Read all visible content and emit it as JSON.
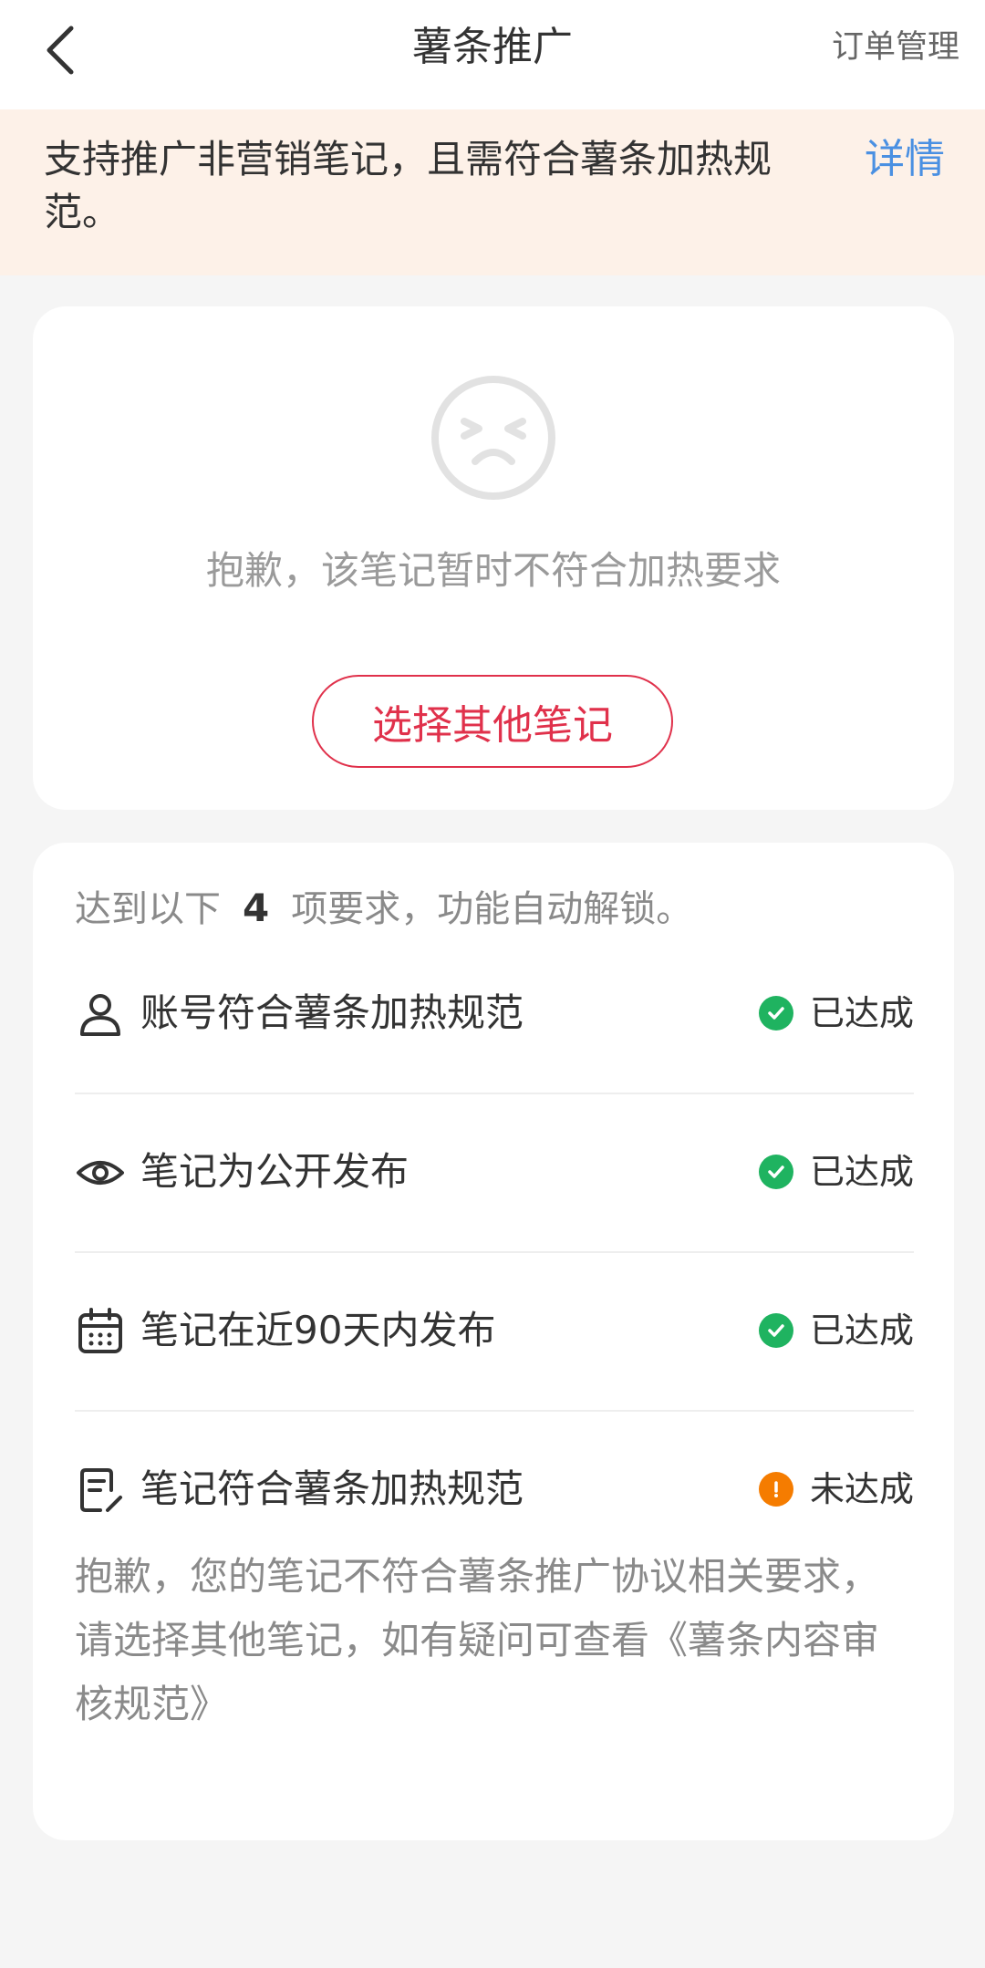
{
  "header": {
    "title": "薯条推广",
    "action_label": "订单管理",
    "back_icon": "back-arrow-icon"
  },
  "notice": {
    "text": "支持推广非营销笔记，且需符合薯条加热规范。",
    "link_label": "详情"
  },
  "empty_state": {
    "icon": "sad-face-icon",
    "message": "抱歉，该笔记暂时不符合加热要求",
    "button_label": "选择其他笔记"
  },
  "requirements": {
    "intro_prefix": "达到以下",
    "intro_count": "4",
    "intro_suffix": "项要求，功能自动解锁。",
    "items": [
      {
        "icon": "user-icon",
        "label": "账号符合薯条加热规范",
        "status": "已达成",
        "status_color": "#1fb360"
      },
      {
        "icon": "eye-icon",
        "label": "笔记为公开发布",
        "status": "已达成",
        "status_color": "#1fb360"
      },
      {
        "icon": "calendar-icon",
        "label": "笔记在近90天内发布",
        "status": "已达成",
        "status_color": "#1fb360"
      },
      {
        "icon": "note-edit-icon",
        "label": "笔记符合薯条加热规范",
        "status": "未达成",
        "status_color": "#f57c00"
      }
    ],
    "detail": "抱歉，您的笔记不符合薯条推广协议相关要求，请选择其他笔记，如有疑问可查看《薯条内容审核规范》"
  },
  "colors": {
    "accent": "#e0314b",
    "link": "#4a90e2",
    "notice_bg": "#fdf1e8",
    "success": "#1fb360",
    "warning": "#f57c00"
  }
}
